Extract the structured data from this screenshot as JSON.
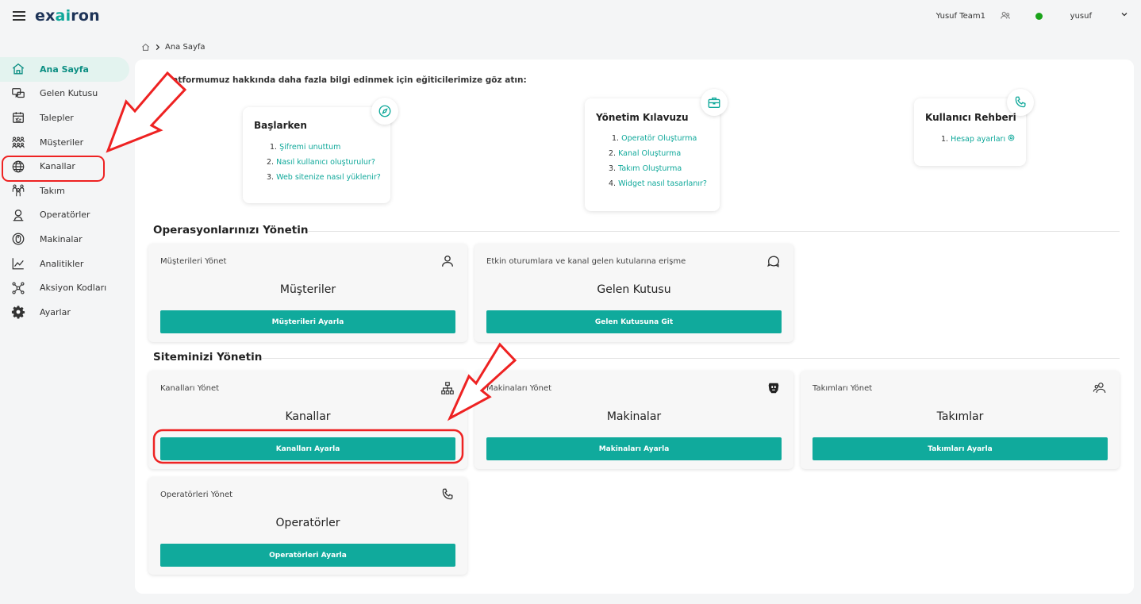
{
  "header": {
    "logo_prefix": "ex",
    "logo_accent": "ai",
    "logo_suffix": "ron",
    "team_name": "Yusuf Team1",
    "user_name": "yusuf"
  },
  "breadcrumb": {
    "current": "Ana Sayfa"
  },
  "sidebar": {
    "items": [
      {
        "label": "Ana Sayfa",
        "icon": "home-icon"
      },
      {
        "label": "Gelen Kutusu",
        "icon": "chat-icon"
      },
      {
        "label": "Talepler",
        "icon": "calendar-check-icon"
      },
      {
        "label": "Müşteriler",
        "icon": "users-group-icon"
      },
      {
        "label": "Kanallar",
        "icon": "globe-icon"
      },
      {
        "label": "Takım",
        "icon": "team-icon"
      },
      {
        "label": "Operatörler",
        "icon": "operator-icon"
      },
      {
        "label": "Makinalar",
        "icon": "machine-icon"
      },
      {
        "label": "Analitikler",
        "icon": "chart-line-icon"
      },
      {
        "label": "Aksiyon Kodları",
        "icon": "network-icon"
      },
      {
        "label": "Ayarlar",
        "icon": "gear-icon"
      }
    ]
  },
  "intro_text": "Platformumuz hakkında daha fazla bilgi edinmek için eğiticilerimize göz atın:",
  "guides": [
    {
      "title": "Başlarken",
      "icon": "compass-icon",
      "items": [
        {
          "num": "1.",
          "text": "Şifremi unuttum"
        },
        {
          "num": "2.",
          "text": "Nasıl kullanıcı oluşturulur?"
        },
        {
          "num": "3.",
          "text": "Web sitenize nasıl yüklenir?"
        }
      ]
    },
    {
      "title": "Yönetim Kılavuzu",
      "icon": "briefcase-icon",
      "items": [
        {
          "num": "1.",
          "text": "Operatör Oluşturma"
        },
        {
          "num": "2.",
          "text": "Kanal Oluşturma"
        },
        {
          "num": "3.",
          "text": "Takım Oluşturma"
        },
        {
          "num": "4.",
          "text": "Widget nasıl tasarlanır?"
        }
      ]
    },
    {
      "title": "Kullanıcı Rehberi",
      "icon": "phone-icon",
      "items": [
        {
          "num": "1.",
          "text": "Hesap ayarları"
        }
      ]
    }
  ],
  "sections": {
    "operations": "Operasyonlarınızı Yönetin",
    "site": "Siteminizi Yönetin"
  },
  "cards": {
    "customers": {
      "subtitle": "Müşterileri Yönet",
      "title": "Müşteriler",
      "button": "Müşterileri Ayarla",
      "icon": "user-icon"
    },
    "inbox": {
      "subtitle": "Etkin oturumlara ve kanal gelen kutularına erişme",
      "title": "Gelen Kutusu",
      "button": "Gelen Kutusuna Git",
      "icon": "chat-bubble-icon"
    },
    "channels": {
      "subtitle": "Kanalları Yönet",
      "title": "Kanallar",
      "button": "Kanalları Ayarla",
      "icon": "sitemap-icon"
    },
    "machines": {
      "subtitle": "Makinaları Yönet",
      "title": "Makinalar",
      "button": "Makinaları Ayarla",
      "icon": "robot-icon"
    },
    "teams": {
      "subtitle": "Takımları Yönet",
      "title": "Takımlar",
      "button": "Takımları Ayarla",
      "icon": "team-users-icon"
    },
    "operators": {
      "subtitle": "Operatörleri Yönet",
      "title": "Operatörler",
      "button": "Operatörleri Ayarla",
      "icon": "phone-icon"
    }
  },
  "colors": {
    "accent": "#10aa9c",
    "brand_dark": "#1d3357",
    "annotation": "#e22222",
    "status_online": "#1aa31a"
  }
}
